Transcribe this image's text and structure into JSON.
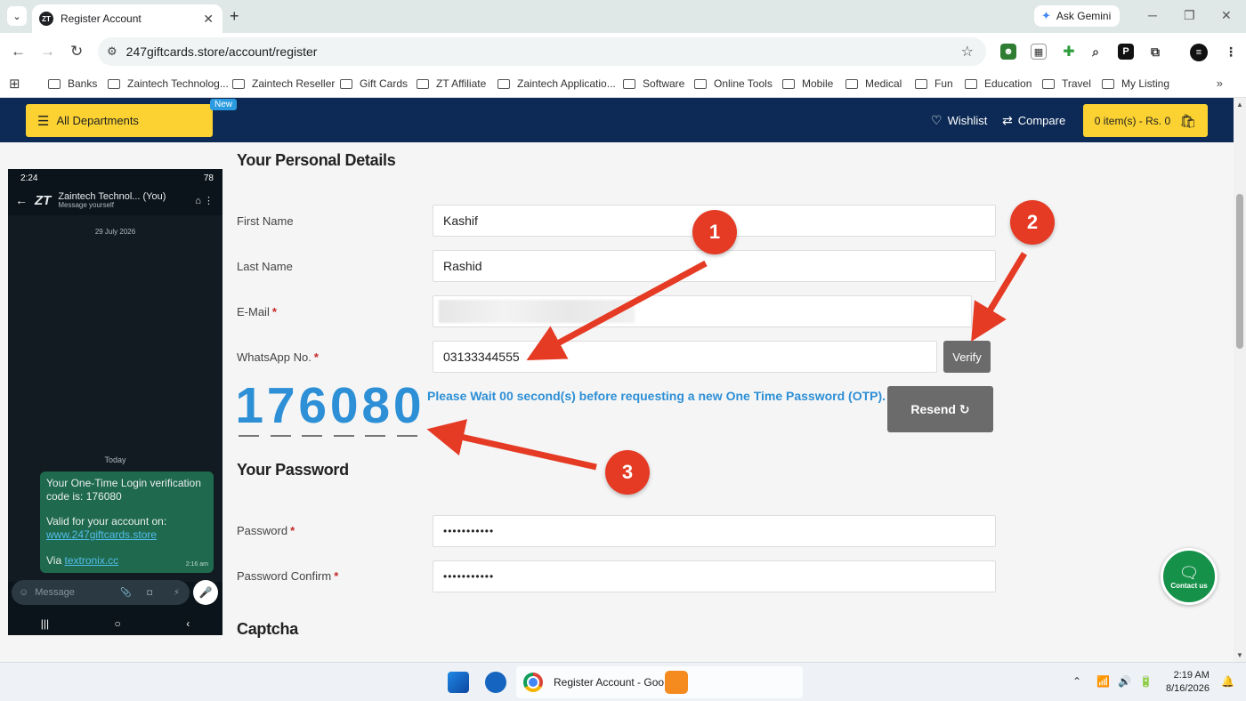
{
  "browser": {
    "tab_title": "Register Account",
    "tab_favicon": "ZT",
    "gemini_label": "Ask Gemini",
    "url": "247giftcards.store/account/register",
    "bookmarks": [
      "Banks",
      "Zaintech Technolog...",
      "Zaintech Reseller",
      "Gift Cards",
      "ZT Affiliate",
      "Zaintech Applicatio...",
      "Software",
      "Online Tools",
      "Mobile",
      "Medical",
      "Fun",
      "Education",
      "Travel",
      "My Listing"
    ]
  },
  "site_header": {
    "departments_label": "All Departments",
    "new_badge": "New",
    "wishlist_label": "Wishlist",
    "compare_label": "Compare",
    "cart_label": "0 item(s) - Rs. 0"
  },
  "phone": {
    "time": "2:24",
    "battery": "78",
    "contact_name": "Zaintech Technol... (You)",
    "contact_sub": "Message yourself",
    "logo": "ZT",
    "date_label": "29 July 2026",
    "today_label": "Today",
    "message_line1": "Your One-Time Login verification code is: 176080",
    "message_line2": "Valid for your account on:",
    "message_link": "www.247giftcards.store",
    "message_via": "Via",
    "message_via_link": "textronix.cc",
    "message_time": "2:16 am",
    "input_placeholder": "Message"
  },
  "form": {
    "personal_title": "Your Personal Details",
    "first_name_label": "First Name",
    "first_name_value": "Kashif",
    "last_name_label": "Last Name",
    "last_name_value": "Rashid",
    "email_label": "E-Mail",
    "whatsapp_label": "WhatsApp No.",
    "whatsapp_value": "03133344555",
    "verify_label": "Verify",
    "otp_digits": [
      "1",
      "7",
      "6",
      "0",
      "8",
      "0"
    ],
    "otp_message": "Please Wait 00 second(s) before requesting a new One Time Password (OTP).",
    "resend_label": "Resend",
    "password_title": "Your Password",
    "password_label": "Password",
    "password_value": "•••••••••••",
    "password_confirm_label": "Password Confirm",
    "password_confirm_value": "•••••••••••",
    "captcha_title": "Captcha",
    "required_mark": "*"
  },
  "contact_us_label": "Contact us",
  "annotations": [
    "1",
    "2",
    "3"
  ],
  "annotation_color": "#e53a24",
  "accent_blue": "#2d8fd6",
  "header_navy": "#0c2a55",
  "button_yellow": "#fbd231",
  "taskbar": {
    "chrome_window_title": "Register Account - Goo",
    "time": "2:19 AM",
    "date": "8/16/2026"
  }
}
